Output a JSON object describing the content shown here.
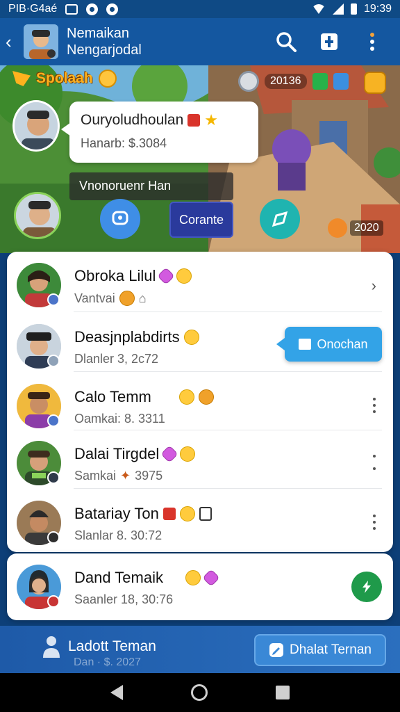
{
  "status_bar": {
    "left_text": "PIB·G4aé",
    "time": "19:39"
  },
  "app_bar": {
    "title": "Nemaikan",
    "subtitle": "Nengarjodal"
  },
  "banner": {
    "ribbon": "Spolaah",
    "coins": "20136",
    "message1": {
      "name": "Ouryoludhoulan",
      "sub": "Hanarb: $.3084"
    },
    "message2": "Vnonoruenr Han",
    "confirm": "Corante",
    "score": "2020"
  },
  "friends": [
    {
      "name": "Obroka Lilul",
      "sub": "Vantvai"
    },
    {
      "name": "Deasjnplabdirts",
      "sub": "Dlanler 3, 2c72"
    },
    {
      "name": "Calo Temm",
      "sub": "Oamkai: 8. 3311"
    },
    {
      "name": "Dalai Tirgdel",
      "sub": "Samkai",
      "sub_value": "3975"
    },
    {
      "name": "Batariay Ton",
      "sub": "Slanlar 8. 30:72"
    }
  ],
  "popup": "Onochan",
  "pinned": {
    "name": "Dand Temaik",
    "sub": "Saanler 18, 30:76"
  },
  "bottom": {
    "left_label": "Ladott Teman",
    "left_sub": "Dan · $. 2027",
    "right_label": "Dhalat Ternan"
  },
  "colors": {
    "primary": "#1457a0",
    "accent": "#33a3e7",
    "fab": "#1f9a4a"
  },
  "icons": [
    "back-arrow-icon",
    "search-icon",
    "share-icon",
    "more-icon",
    "star-icon",
    "chevron-right-icon",
    "dots-icon",
    "lightning-icon",
    "person-icon"
  ]
}
